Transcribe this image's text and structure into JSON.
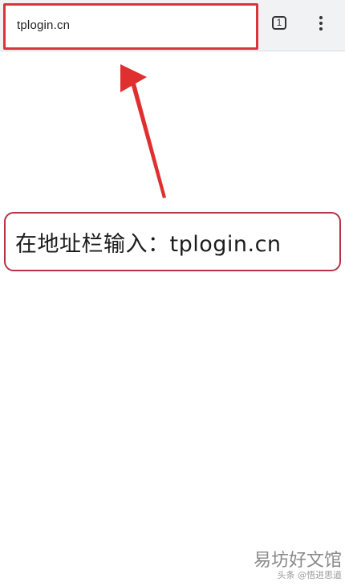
{
  "browser": {
    "address_bar": {
      "value": "tplogin.cn"
    },
    "tab_switcher": {
      "count": "1"
    },
    "menu": {
      "icon": "more-vertical-icon"
    }
  },
  "content": {
    "instruction": "在地址栏输入：tplogin.cn"
  },
  "watermark": {
    "title": "易坊好文馆",
    "subtitle": "头条 @悟进思道"
  },
  "colors": {
    "highlight": "#d9333f",
    "instruction_border": "#b43344"
  }
}
